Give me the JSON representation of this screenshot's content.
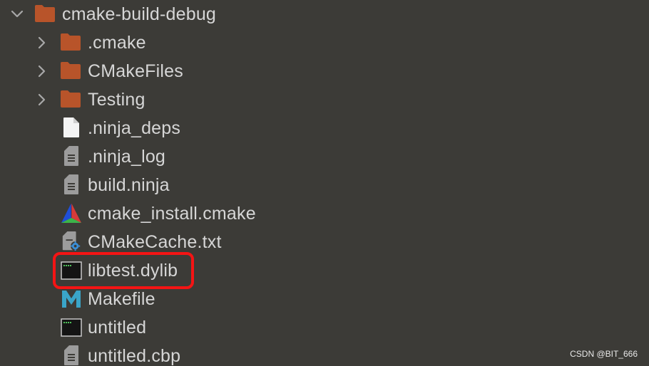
{
  "tree": {
    "root": {
      "label": "cmake-build-debug",
      "expanded": true,
      "icon": "folder-icon"
    },
    "items": [
      {
        "label": ".cmake",
        "type": "folder",
        "icon": "folder-icon",
        "expandable": true
      },
      {
        "label": "CMakeFiles",
        "type": "folder",
        "icon": "folder-icon",
        "expandable": true
      },
      {
        "label": "Testing",
        "type": "folder",
        "icon": "folder-icon",
        "expandable": true
      },
      {
        "label": ".ninja_deps",
        "type": "file",
        "icon": "blank-file-icon"
      },
      {
        "label": ".ninja_log",
        "type": "file",
        "icon": "text-file-icon"
      },
      {
        "label": "build.ninja",
        "type": "file",
        "icon": "text-file-icon"
      },
      {
        "label": "cmake_install.cmake",
        "type": "file",
        "icon": "cmake-icon"
      },
      {
        "label": "CMakeCache.txt",
        "type": "file",
        "icon": "config-file-icon"
      },
      {
        "label": "libtest.dylib",
        "type": "file",
        "icon": "executable-icon"
      },
      {
        "label": "Makefile",
        "type": "file",
        "icon": "makefile-icon"
      },
      {
        "label": "untitled",
        "type": "file",
        "icon": "executable-icon"
      },
      {
        "label": "untitled.cbp",
        "type": "file",
        "icon": "text-file-icon"
      }
    ]
  },
  "annotation": {
    "highlighted_item": "libtest.dylib",
    "color": "#f41414"
  },
  "watermark": "CSDN @BIT_666",
  "colors": {
    "background": "#3c3b37",
    "folder": "#b8542a",
    "text": "#d6d6d6"
  }
}
